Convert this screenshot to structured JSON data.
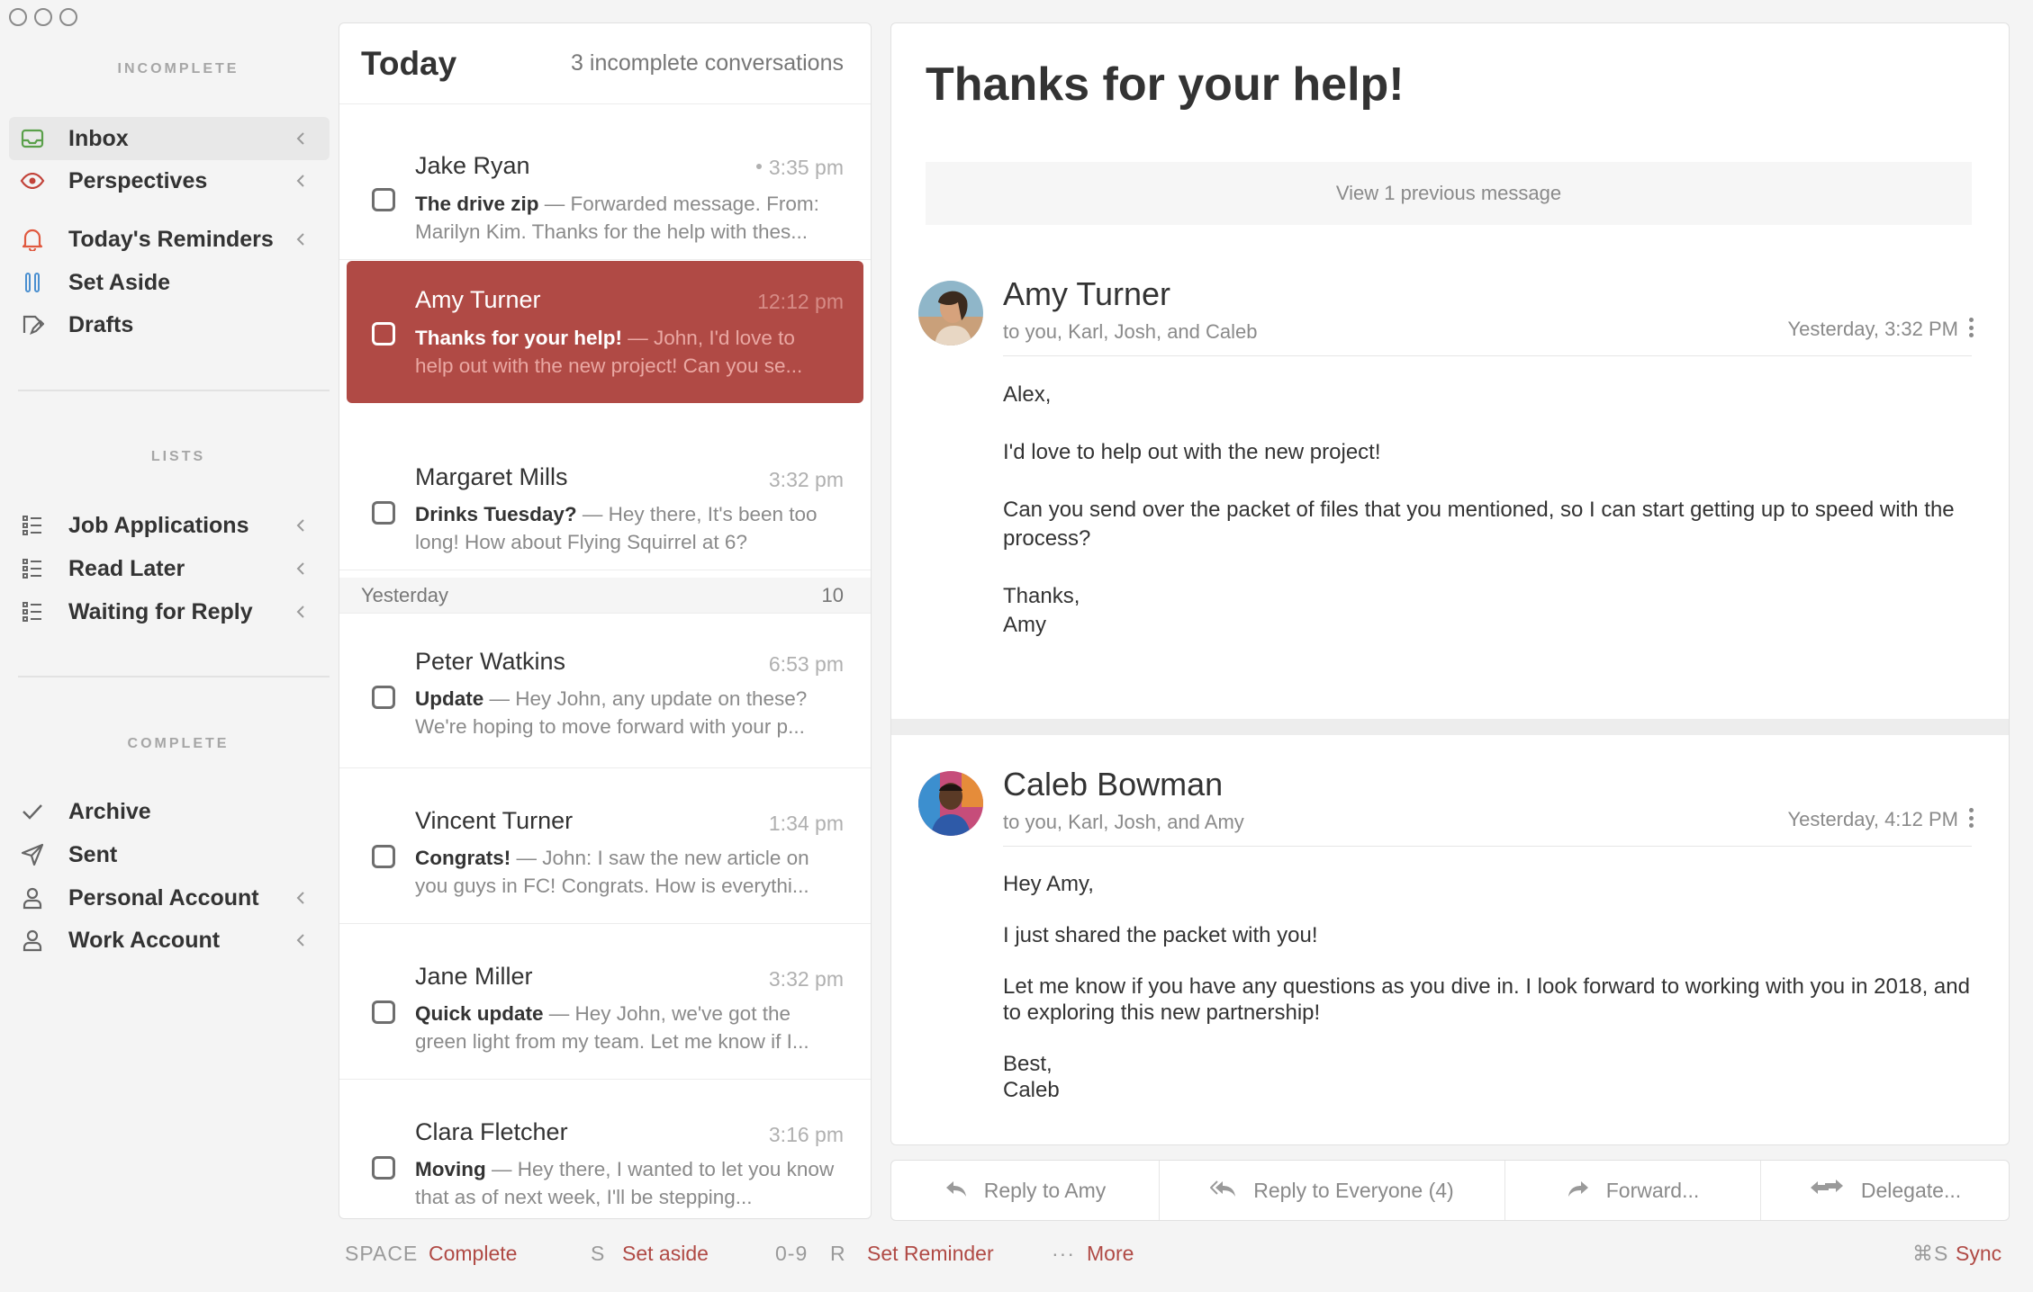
{
  "sidebar": {
    "incomplete_title": "INCOMPLETE",
    "lists_title": "LISTS",
    "complete_title": "COMPLETE",
    "items": {
      "inbox": "Inbox",
      "perspectives": "Perspectives",
      "reminders": "Today's Reminders",
      "set_aside": "Set Aside",
      "drafts": "Drafts",
      "job_applications": "Job Applications",
      "read_later": "Read Later",
      "waiting": "Waiting for Reply",
      "archive": "Archive",
      "sent": "Sent",
      "personal": "Personal Account",
      "work": "Work Account"
    }
  },
  "list": {
    "title": "Today",
    "count": "3 incomplete conversations",
    "yesterday_label": "Yesterday",
    "yesterday_count": "10",
    "rows": [
      {
        "sender": "Jake Ryan",
        "time": "3:35 pm",
        "subject": "The drive zip",
        "preview": " — Forwarded message. From: Marilyn Kim. Thanks for the help with thes..."
      },
      {
        "sender": "Amy Turner",
        "time": "12:12 pm",
        "subject": "Thanks for your help!",
        "preview": " — John, I'd love to help out with the new project! Can you se..."
      },
      {
        "sender": "Margaret Mills",
        "time": "3:32 pm",
        "subject": "Drinks Tuesday?",
        "preview": " — Hey there, It's been too long! How about Flying Squirrel at 6?"
      },
      {
        "sender": "Peter Watkins",
        "time": "6:53 pm",
        "subject": "Update",
        "preview": " — Hey John, any update on these? We're hoping to move forward with your p..."
      },
      {
        "sender": "Vincent Turner",
        "time": "1:34 pm",
        "subject": "Congrats!",
        "preview": " — John: I saw the new article on you guys in FC! Congrats. How is everythi..."
      },
      {
        "sender": "Jane Miller",
        "time": "3:32 pm",
        "subject": "Quick update",
        "preview": " — Hey John, we've got the green light from my team. Let me know if I..."
      },
      {
        "sender": "Clara Fletcher",
        "time": "3:16 pm",
        "subject": "Moving",
        "preview": " — Hey there, I wanted to let you know that as of next week, I'll be stepping..."
      }
    ]
  },
  "detail": {
    "subject": "Thanks for your help!",
    "previous": "View 1 previous message",
    "messages": [
      {
        "name": "Amy Turner",
        "to": "to you, Karl, Josh, and Caleb",
        "time": "Yesterday, 3:32 PM",
        "body": {
          "p1": "Alex,",
          "p2": "I'd love to help out with the new project!",
          "p3": "Can you send over the packet of files that you mentioned, so I can start getting up to speed with the process?",
          "p4a": "Thanks,",
          "p4b": "Amy"
        }
      },
      {
        "name": "Caleb Bowman",
        "to": "to you, Karl, Josh, and Amy",
        "time": "Yesterday, 4:12 PM",
        "body": {
          "p1": "Hey Amy,",
          "p2": "I just shared the packet with you!",
          "p3": "Let me know if you have any questions as you dive in. I look forward to working with you in 2018, and to exploring this new partnership!",
          "p4a": "Best,",
          "p4b": "Caleb"
        }
      }
    ]
  },
  "actions": {
    "reply": "Reply to Amy",
    "reply_all": "Reply to Everyone (4)",
    "forward": "Forward...",
    "delegate": "Delegate..."
  },
  "footer": {
    "space_key": "SPACE",
    "complete": "Complete",
    "s_key": "S",
    "set_aside": "Set aside",
    "num_key": "0-9",
    "r_key": "R",
    "set_reminder": "Set Reminder",
    "more_key": "···",
    "more": "More",
    "sync_key": "⌘S",
    "sync": "Sync"
  },
  "colors": {
    "accent": "#b04a45",
    "inbox_icon": "#5aa04a",
    "perspectives_icon": "#c2433a",
    "reminder_icon": "#e0593f",
    "set_aside_icon": "#4a8fd0"
  }
}
